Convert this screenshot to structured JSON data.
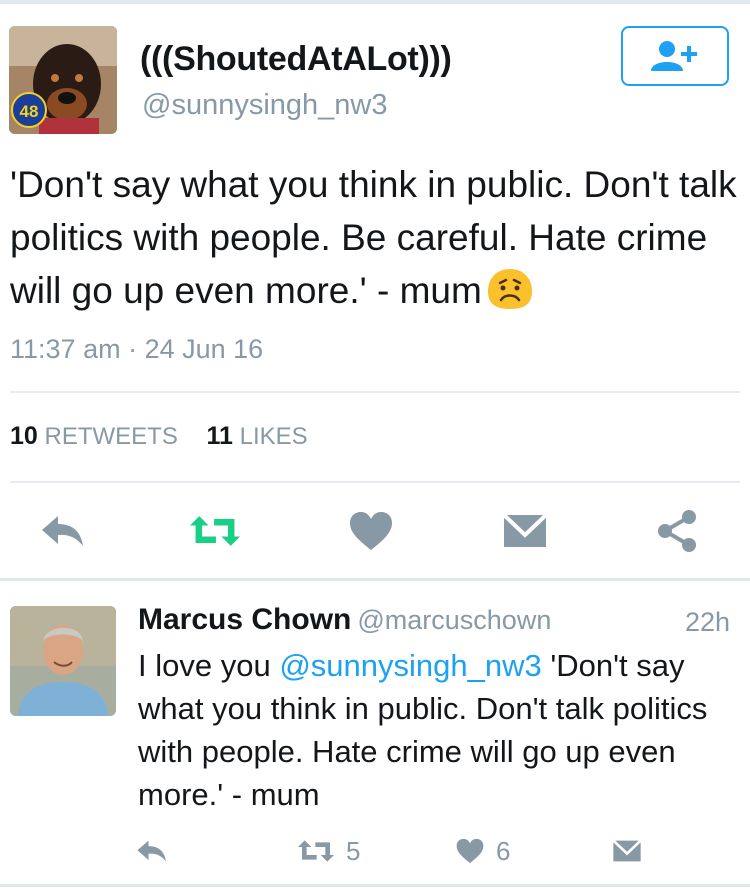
{
  "tweet": {
    "display_name": "(((ShoutedAtALot)))",
    "handle": "@sunnysingh_nw3",
    "avatar_badge": "48",
    "text": "'Don't say what you think in public. Don't talk politics with people. Be careful. Hate crime will go up even more.' - mum",
    "emoji": "worried-face",
    "timestamp": "11:37 am · 24 Jun 16",
    "retweet_count": "10",
    "retweet_label": "RETWEETS",
    "like_count": "11",
    "like_label": "LIKES"
  },
  "actions": [
    "reply-icon",
    "retweet-icon",
    "like-icon",
    "message-icon",
    "share-icon"
  ],
  "reply": {
    "display_name": "Marcus Chown",
    "handle": "@marcuschown",
    "time": "22h",
    "text_prefix": "I love you ",
    "mention": "@sunnysingh_nw3",
    "text_suffix": " 'Don't say what you think in public. Don't talk politics with people. Hate crime will go up even more.' - mum",
    "retweet_count": "5",
    "like_count": "6"
  },
  "colors": {
    "accent": "#1da1f2",
    "retweeted": "#19cf86",
    "icon_gray": "#8899a6",
    "text": "#14171a"
  }
}
